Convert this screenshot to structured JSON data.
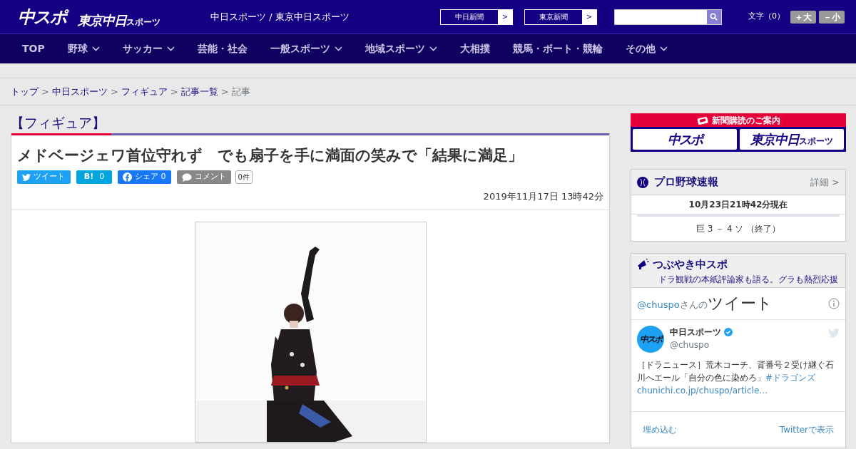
{
  "header": {
    "logo_main": "中スポ",
    "logo_sub": "東京中日",
    "logo_sub_small": "スポーツ",
    "site_title": "中日スポーツ / 東京中日スポーツ",
    "paper_links": [
      {
        "label": "中日新聞",
        "arrow": ">"
      },
      {
        "label": "東京新聞",
        "arrow": ">"
      }
    ],
    "font_size_label": "文字（0）",
    "font_buttons": [
      {
        "label": "＋大"
      },
      {
        "label": "－小"
      }
    ]
  },
  "nav": [
    {
      "label": "TOP",
      "has_menu": false
    },
    {
      "label": "野球",
      "has_menu": true
    },
    {
      "label": "サッカー",
      "has_menu": true
    },
    {
      "label": "芸能・社会",
      "has_menu": false
    },
    {
      "label": "一般スポーツ",
      "has_menu": true
    },
    {
      "label": "地域スポーツ",
      "has_menu": true
    },
    {
      "label": "大相撲",
      "has_menu": false
    },
    {
      "label": "競馬・ボート・競輪",
      "has_menu": false
    },
    {
      "label": "その他",
      "has_menu": true
    }
  ],
  "breadcrumb": [
    {
      "label": "トップ",
      "link": true
    },
    {
      "label": "中日スポーツ",
      "link": true
    },
    {
      "label": "フィギュア",
      "link": true
    },
    {
      "label": "記事一覧",
      "link": true
    },
    {
      "label": "記事",
      "link": false
    }
  ],
  "category": "【フィギュア】",
  "article": {
    "title": "メドベージェワ首位守れず　でも扇子を手に満面の笑みで「結果に満足」",
    "share": [
      {
        "kind": "twitter",
        "label": "ツイート"
      },
      {
        "kind": "hatena",
        "label": "B!",
        "count": "0"
      },
      {
        "kind": "facebook",
        "label": "シェア 0"
      },
      {
        "kind": "comment",
        "label": "コメント",
        "count": "0件"
      }
    ],
    "date": "2019年11月17日 13時42分"
  },
  "sidebar": {
    "subscribe": {
      "title": "新聞購読のご案内",
      "logo_main": "中スポ",
      "logo_sub": "東京中日",
      "logo_sub_small": "スポーツ"
    },
    "baseball": {
      "title": "プロ野球速報",
      "more": "詳細 >",
      "updated": "10月23日21時42分現在",
      "score": "巨 3 － 4 ソ （終了）"
    },
    "tweets": {
      "title": "つぶやき中スポ",
      "subtitle": "ドラ観戦の本紙評論家も語る。グラも熱烈応援",
      "handle": "@chuspo",
      "handle_suffix": "さんの",
      "heading": "ツイート",
      "tweet": {
        "avatar": "中スポ",
        "name": "中日スポーツ",
        "verified": true,
        "user": "@chuspo",
        "text": "［ドラニュース］荒木コーチ、背番号２受け継ぐ石川へエール「自分の色に染めろ」",
        "hashtag": "#ドラゴンズ",
        "url": "chunichi.co.jp/chuspo/article…"
      },
      "embed": "埋め込む",
      "view": "Twitterで表示"
    }
  }
}
